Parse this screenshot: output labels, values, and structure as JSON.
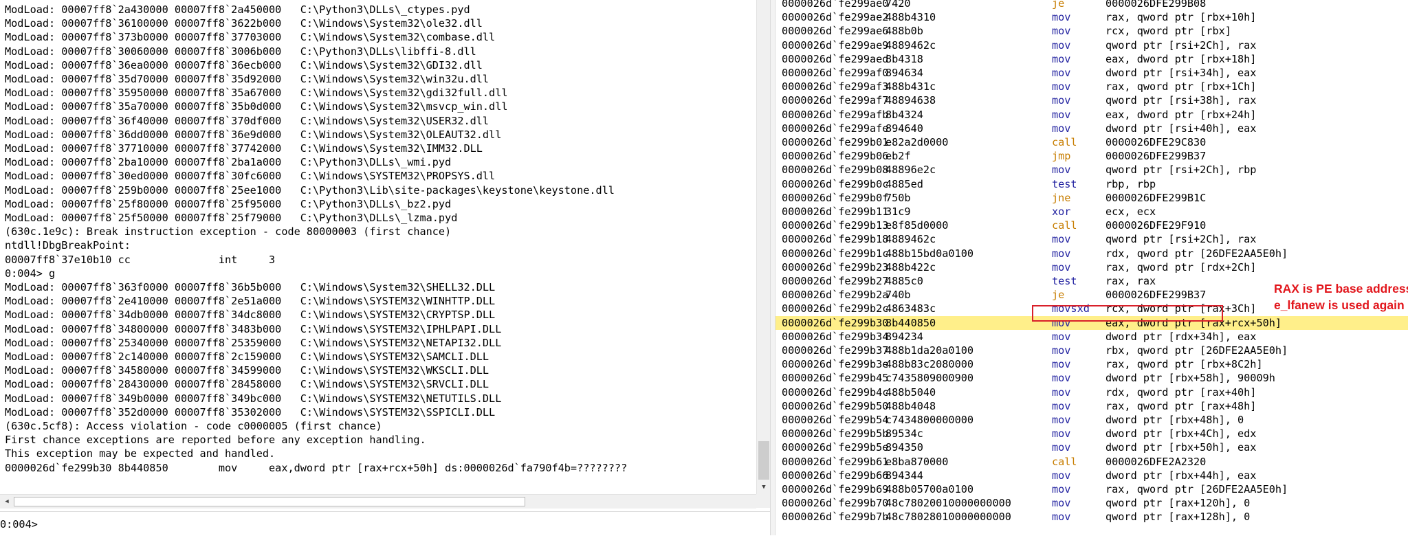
{
  "command": {
    "lines": [
      "ModLoad: 00007ff8`2a430000 00007ff8`2a450000   C:\\Python3\\DLLs\\_ctypes.pyd",
      "ModLoad: 00007ff8`36100000 00007ff8`3622b000   C:\\Windows\\System32\\ole32.dll",
      "ModLoad: 00007ff8`373b0000 00007ff8`37703000   C:\\Windows\\System32\\combase.dll",
      "ModLoad: 00007ff8`30060000 00007ff8`3006b000   C:\\Python3\\DLLs\\libffi-8.dll",
      "ModLoad: 00007ff8`36ea0000 00007ff8`36ecb000   C:\\Windows\\System32\\GDI32.dll",
      "ModLoad: 00007ff8`35d70000 00007ff8`35d92000   C:\\Windows\\System32\\win32u.dll",
      "ModLoad: 00007ff8`35950000 00007ff8`35a67000   C:\\Windows\\System32\\gdi32full.dll",
      "ModLoad: 00007ff8`35a70000 00007ff8`35b0d000   C:\\Windows\\System32\\msvcp_win.dll",
      "ModLoad: 00007ff8`36f40000 00007ff8`370df000   C:\\Windows\\System32\\USER32.dll",
      "ModLoad: 00007ff8`36dd0000 00007ff8`36e9d000   C:\\Windows\\System32\\OLEAUT32.dll",
      "ModLoad: 00007ff8`37710000 00007ff8`37742000   C:\\Windows\\System32\\IMM32.DLL",
      "ModLoad: 00007ff8`2ba10000 00007ff8`2ba1a000   C:\\Python3\\DLLs\\_wmi.pyd",
      "ModLoad: 00007ff8`30ed0000 00007ff8`30fc6000   C:\\Windows\\SYSTEM32\\PROPSYS.dll",
      "ModLoad: 00007ff8`259b0000 00007ff8`25ee1000   C:\\Python3\\Lib\\site-packages\\keystone\\keystone.dll",
      "ModLoad: 00007ff8`25f80000 00007ff8`25f95000   C:\\Python3\\DLLs\\_bz2.pyd",
      "ModLoad: 00007ff8`25f50000 00007ff8`25f79000   C:\\Python3\\DLLs\\_lzma.pyd",
      "(630c.1e9c): Break instruction exception - code 80000003 (first chance)",
      "ntdll!DbgBreakPoint:",
      "00007ff8`37e10b10 cc              int     3",
      "0:004> g",
      "ModLoad: 00007ff8`363f0000 00007ff8`36b5b000   C:\\Windows\\System32\\SHELL32.DLL",
      "ModLoad: 00007ff8`2e410000 00007ff8`2e51a000   C:\\Windows\\SYSTEM32\\WINHTTP.DLL",
      "ModLoad: 00007ff8`34db0000 00007ff8`34dc8000   C:\\Windows\\SYSTEM32\\CRYPTSP.DLL",
      "ModLoad: 00007ff8`34800000 00007ff8`3483b000   C:\\Windows\\SYSTEM32\\IPHLPAPI.DLL",
      "ModLoad: 00007ff8`25340000 00007ff8`25359000   C:\\Windows\\SYSTEM32\\NETAPI32.DLL",
      "ModLoad: 00007ff8`2c140000 00007ff8`2c159000   C:\\Windows\\SYSTEM32\\SAMCLI.DLL",
      "ModLoad: 00007ff8`34580000 00007ff8`34599000   C:\\Windows\\SYSTEM32\\WKSCLI.DLL",
      "ModLoad: 00007ff8`28430000 00007ff8`28458000   C:\\Windows\\SYSTEM32\\SRVCLI.DLL",
      "ModLoad: 00007ff8`349b0000 00007ff8`349bc000   C:\\Windows\\SYSTEM32\\NETUTILS.DLL",
      "ModLoad: 00007ff8`352d0000 00007ff8`35302000   C:\\Windows\\SYSTEM32\\SSPICLI.DLL",
      "(630c.5cf8): Access violation - code c0000005 (first chance)",
      "First chance exceptions are reported before any exception handling.",
      "This exception may be expected and handled.",
      "0000026d`fe299b30 8b440850        mov     eax,dword ptr [rax+rcx+50h] ds:0000026d`fa790f4b=????????"
    ],
    "prompt": "0:004>",
    "input_value": ""
  },
  "disassembly": {
    "current_index": 23,
    "boxed_index": 22,
    "rows": [
      [
        "0000026d`fe299ae0",
        "7420",
        "je",
        "0000026DFE299B08"
      ],
      [
        "0000026d`fe299ae2",
        "488b4310",
        "mov",
        "rax, qword ptr [rbx+10h]"
      ],
      [
        "0000026d`fe299ae6",
        "488b0b",
        "mov",
        "rcx, qword ptr [rbx]"
      ],
      [
        "0000026d`fe299ae9",
        "4889462c",
        "mov",
        "qword ptr [rsi+2Ch], rax"
      ],
      [
        "0000026d`fe299aed",
        "8b4318",
        "mov",
        "eax, dword ptr [rbx+18h]"
      ],
      [
        "0000026d`fe299af0",
        "894634",
        "mov",
        "dword ptr [rsi+34h], eax"
      ],
      [
        "0000026d`fe299af3",
        "488b431c",
        "mov",
        "rax, qword ptr [rbx+1Ch]"
      ],
      [
        "0000026d`fe299af7",
        "48894638",
        "mov",
        "qword ptr [rsi+38h], rax"
      ],
      [
        "0000026d`fe299afb",
        "8b4324",
        "mov",
        "eax, dword ptr [rbx+24h]"
      ],
      [
        "0000026d`fe299afe",
        "894640",
        "mov",
        "dword ptr [rsi+40h], eax"
      ],
      [
        "0000026d`fe299b01",
        "e82a2d0000",
        "call",
        "0000026DFE29C830"
      ],
      [
        "0000026d`fe299b06",
        "eb2f",
        "jmp",
        "0000026DFE299B37"
      ],
      [
        "0000026d`fe299b08",
        "48896e2c",
        "mov",
        "qword ptr [rsi+2Ch], rbp"
      ],
      [
        "0000026d`fe299b0c",
        "4885ed",
        "test",
        "rbp, rbp"
      ],
      [
        "0000026d`fe299b0f",
        "750b",
        "jne",
        "0000026DFE299B1C"
      ],
      [
        "0000026d`fe299b11",
        "31c9",
        "xor",
        "ecx, ecx"
      ],
      [
        "0000026d`fe299b13",
        "e8f85d0000",
        "call",
        "0000026DFE29F910"
      ],
      [
        "0000026d`fe299b18",
        "4889462c",
        "mov",
        "qword ptr [rsi+2Ch], rax"
      ],
      [
        "0000026d`fe299b1c",
        "488b15bd0a0100",
        "mov",
        "rdx, qword ptr [26DFE2AA5E0h]"
      ],
      [
        "0000026d`fe299b23",
        "488b422c",
        "mov",
        "rax, qword ptr [rdx+2Ch]"
      ],
      [
        "0000026d`fe299b27",
        "4885c0",
        "test",
        "rax, rax"
      ],
      [
        "0000026d`fe299b2a",
        "740b",
        "je",
        "0000026DFE299B37"
      ],
      [
        "0000026d`fe299b2c",
        "4863483c",
        "movsxd",
        "rcx, dword ptr [rax+3Ch]"
      ],
      [
        "0000026d`fe299b30",
        "8b440850",
        "mov",
        "eax, dword ptr [rax+rcx+50h]"
      ],
      [
        "0000026d`fe299b34",
        "894234",
        "mov",
        "dword ptr [rdx+34h], eax"
      ],
      [
        "0000026d`fe299b37",
        "488b1da20a0100",
        "mov",
        "rbx, qword ptr [26DFE2AA5E0h]"
      ],
      [
        "0000026d`fe299b3e",
        "488b83c2080000",
        "mov",
        "rax, qword ptr [rbx+8C2h]"
      ],
      [
        "0000026d`fe299b45",
        "c7435809000900",
        "mov",
        "dword ptr [rbx+58h], 90009h"
      ],
      [
        "0000026d`fe299b4c",
        "488b5040",
        "mov",
        "rdx, qword ptr [rax+40h]"
      ],
      [
        "0000026d`fe299b50",
        "488b4048",
        "mov",
        "rax, qword ptr [rax+48h]"
      ],
      [
        "0000026d`fe299b54",
        "c7434800000000",
        "mov",
        "dword ptr [rbx+48h], 0"
      ],
      [
        "0000026d`fe299b5b",
        "89534c",
        "mov",
        "dword ptr [rbx+4Ch], edx"
      ],
      [
        "0000026d`fe299b5e",
        "894350",
        "mov",
        "dword ptr [rbx+50h], eax"
      ],
      [
        "0000026d`fe299b61",
        "e8ba870000",
        "call",
        "0000026DFE2A2320"
      ],
      [
        "0000026d`fe299b66",
        "894344",
        "mov",
        "dword ptr [rbx+44h], eax"
      ],
      [
        "0000026d`fe299b69",
        "488b05700a0100",
        "mov",
        "rax, qword ptr [26DFE2AA5E0h]"
      ],
      [
        "0000026d`fe299b70",
        "48c78020010000000000",
        "mov",
        "qword ptr [rax+120h], 0"
      ],
      [
        "0000026d`fe299b7b",
        "48c78028010000000000",
        "mov",
        "qword ptr [rax+128h], 0"
      ]
    ]
  },
  "annotations": {
    "line1": "RAX is PE base address",
    "line2": "e_lfanew is used again"
  },
  "colors": {
    "mnemonic": "#1f1f9f",
    "branch_mnemonic": "#c77d00",
    "current_line": "#ffef8a",
    "annotation": "#e2161c"
  }
}
